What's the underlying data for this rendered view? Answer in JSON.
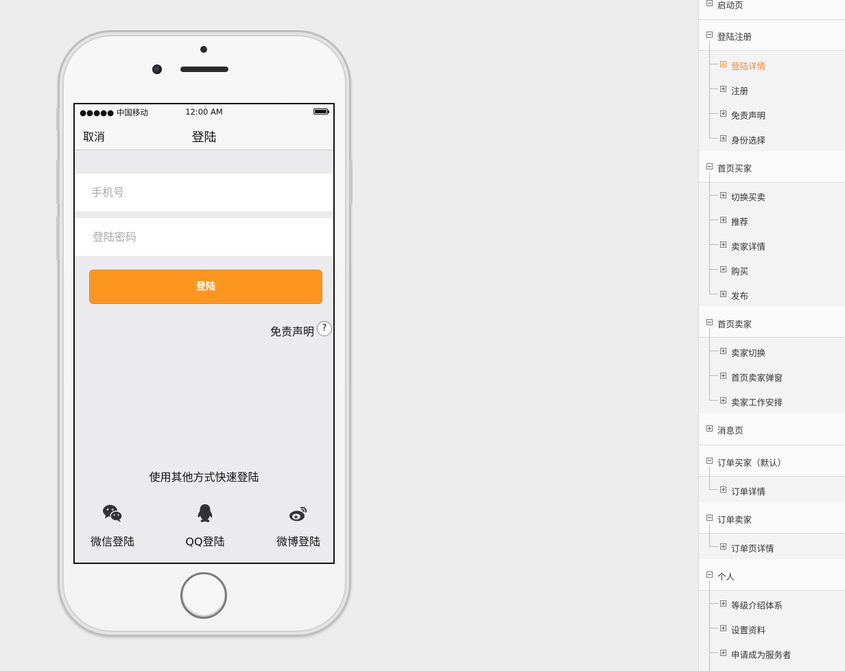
{
  "phone": {
    "status": {
      "carrier": "●●●●● 中国移动",
      "time": "12:00 AM"
    },
    "nav": {
      "cancel": "取消",
      "title": "登陆"
    },
    "form": {
      "phone_placeholder": "手机号",
      "password_placeholder": "登陆密码",
      "login_button": "登陆"
    },
    "disclaimer": {
      "label": "免责声明",
      "help": "?"
    },
    "quick_login": {
      "title": "使用其他方式快速登陆",
      "wechat": "微信登陆",
      "qq": "QQ登陆",
      "weibo": "微博登陆"
    }
  },
  "tree": {
    "s0": {
      "title": "启动页"
    },
    "s1": {
      "title": "登陆注册",
      "items": [
        "登陆详情",
        "注册",
        "免责声明",
        "身份选择"
      ]
    },
    "s2": {
      "title": "首页买家",
      "items": [
        "切换买卖",
        "推荐",
        "卖家详情",
        "购买",
        "发布"
      ]
    },
    "s3": {
      "title": "首页卖家",
      "items": [
        "卖家切换",
        "首页卖家弹窗",
        "卖家工作安排"
      ]
    },
    "s4": {
      "title": "消息页"
    },
    "s5": {
      "title": "订单买家（默认）",
      "items": [
        "订单详情"
      ]
    },
    "s6": {
      "title": "订单卖家",
      "items": [
        "订单页详情"
      ]
    },
    "s7": {
      "title": "个人",
      "items": [
        "等级介绍体系",
        "设置资料",
        "申请成为服务者"
      ]
    }
  },
  "colors": {
    "accent": "#fd9620",
    "active_tree": "#f08a3c"
  },
  "icons": {
    "wechat": "wechat-icon",
    "qq": "qq-icon",
    "weibo": "weibo-icon"
  }
}
